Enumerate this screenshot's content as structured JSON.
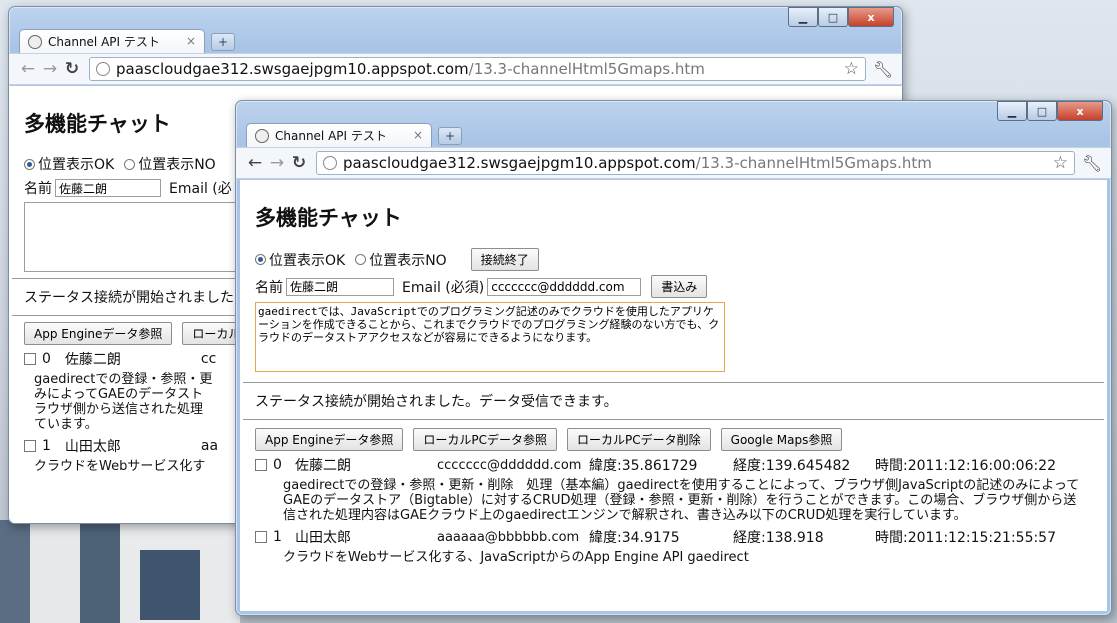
{
  "tab": {
    "title": "Channel API テスト",
    "close": "×",
    "new_tab": "+"
  },
  "address": {
    "host": "paascloudgae312.swsgaejpgm10.appspot.com",
    "path": "/13.3-channelHtml5Gmaps.htm"
  },
  "page": {
    "heading": "多機能チャット",
    "radio_ok": "位置表示OK",
    "radio_no": "位置表示NO",
    "end_button": "接続終了",
    "name_label": "名前",
    "name_value": "佐藤二朗",
    "email_label": "Email (必須)",
    "email_value": "ccccccc@dddddd.com",
    "write_button": "書込み",
    "message": "gaedirectでは、JavaScriptでのプログラミング記述のみでクラウドを使用したアプリケーションを作成できることから、これまでクラウドでのプログラミング経験のない方でも、クラウドのデータストアアクセスなどが容易にできるようになります。",
    "status": "ステータス接続が開始されました。データ受信できます。",
    "buttons": [
      "App Engineデータ参照",
      "ローカルPCデータ参照",
      "ローカルPCデータ削除",
      "Google Maps参照"
    ]
  },
  "back_window": {
    "radio_no_partial": "位置表示NO",
    "email_partial": "Email (必",
    "status_partial": "ステータス接続が開始されました",
    "btn_partial": "ローカル",
    "rec0_email_partial": "cc",
    "rec1_email_partial": "aa",
    "rec0_body": "gaedirectでの登録・参照・更\nみによってGAEのデータスト\nラウザ側から送信された処理\nています。",
    "rec1_body": "クラウドをWebサービス化す"
  },
  "records": [
    {
      "index": "0",
      "name": "佐藤二朗",
      "email": "ccccccc@dddddd.com",
      "lat": "緯度:35.861729",
      "lng": "経度:139.645482",
      "time": "時間:2011:12:16:00:06:22",
      "body": "gaedirectでの登録・参照・更新・削除　処理（基本編）gaedirectを使用することによって、ブラウザ側JavaScriptの記述のみによってGAEのデータストア（Bigtable）に対するCRUD処理（登録・参照・更新・削除）を行うことができます。この場合、ブラウザ側から送信された処理内容はGAEクラウド上のgaedirectエンジンで解釈され、書き込み以下のCRUD処理を実行しています。"
    },
    {
      "index": "1",
      "name": "山田太郎",
      "email": "aaaaaa@bbbbbb.com",
      "lat": "緯度:34.9175",
      "lng": "経度:138.918",
      "time": "時間:2011:12:15:21:55:57",
      "body": "クラウドをWebサービス化する、JavaScriptからのApp Engine API gaedirect"
    }
  ],
  "window_controls": {
    "minimize": "▁",
    "maximize": "□",
    "close": "x"
  }
}
